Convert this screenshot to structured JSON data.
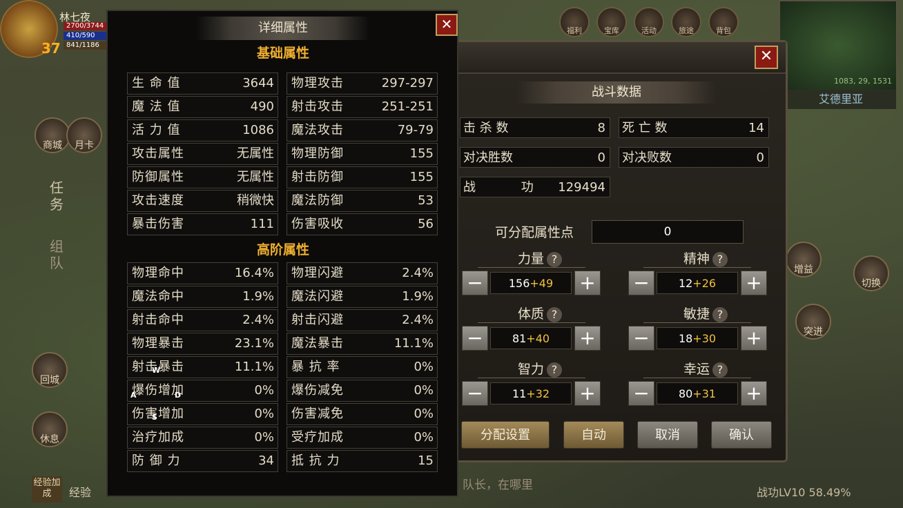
{
  "hud": {
    "name": "林七夜",
    "level": "37",
    "hp": "2700/3744",
    "mp": "410/590",
    "sp": "841/1186"
  },
  "top_icons": [
    "福利",
    "宝库",
    "活动",
    "旅途",
    "背包"
  ],
  "minimap": {
    "coord": "1083, 29, 1531"
  },
  "region_name": "艾德里亚",
  "left_hud": [
    "商城",
    "月卡",
    "回城",
    "休息"
  ],
  "left_tabs": [
    "任务",
    "组队"
  ],
  "right_hud": [
    "增益",
    "突进",
    "切换"
  ],
  "detail_panel": {
    "title": "详细属性",
    "close": "✕",
    "basic_title": "基础属性",
    "advanced_title": "高阶属性",
    "basic_left": [
      {
        "label": "生 命 值",
        "value": "3644"
      },
      {
        "label": "魔 法 值",
        "value": "490"
      },
      {
        "label": "活 力 值",
        "value": "1086"
      },
      {
        "label": "攻击属性",
        "value": "无属性"
      },
      {
        "label": "防御属性",
        "value": "无属性"
      },
      {
        "label": "攻击速度",
        "value": "稍微快"
      },
      {
        "label": "暴击伤害",
        "value": "111"
      }
    ],
    "basic_right": [
      {
        "label": "物理攻击",
        "value": "297-297"
      },
      {
        "label": "射击攻击",
        "value": "251-251"
      },
      {
        "label": "魔法攻击",
        "value": "79-79"
      },
      {
        "label": "物理防御",
        "value": "155"
      },
      {
        "label": "射击防御",
        "value": "155"
      },
      {
        "label": "魔法防御",
        "value": "53"
      },
      {
        "label": "伤害吸收",
        "value": "56"
      }
    ],
    "adv_left": [
      {
        "label": "物理命中",
        "value": "16.4%"
      },
      {
        "label": "魔法命中",
        "value": "1.9%"
      },
      {
        "label": "射击命中",
        "value": "2.4%"
      },
      {
        "label": "物理暴击",
        "value": "23.1%"
      },
      {
        "label": "射击暴击",
        "value": "11.1%"
      },
      {
        "label": "爆伤增加",
        "value": "0%"
      },
      {
        "label": "伤害增加",
        "value": "0%"
      },
      {
        "label": "治疗加成",
        "value": "0%"
      },
      {
        "label": "防 御 力",
        "value": "34"
      }
    ],
    "adv_right": [
      {
        "label": "物理闪避",
        "value": "2.4%"
      },
      {
        "label": "魔法闪避",
        "value": "1.9%"
      },
      {
        "label": "射击闪避",
        "value": "2.4%"
      },
      {
        "label": "魔法暴击",
        "value": "11.1%"
      },
      {
        "label": "暴 抗 率",
        "value": "0%"
      },
      {
        "label": "爆伤减免",
        "value": "0%"
      },
      {
        "label": "伤害减免",
        "value": "0%"
      },
      {
        "label": "受疗加成",
        "value": "0%"
      },
      {
        "label": "抵 抗 力",
        "value": "15"
      }
    ]
  },
  "keys": {
    "w": "W",
    "a": "A",
    "s": "S",
    "d": "D"
  },
  "combat_panel": {
    "close": "✕",
    "title": "战斗数据",
    "kills_label": "击 杀 数",
    "kills": "8",
    "deaths_label": "死 亡 数",
    "deaths": "14",
    "duel_win_label": "对决胜数",
    "duel_win": "0",
    "duel_lose_label": "对决败数",
    "duel_lose": "0",
    "merit_label": "战 功",
    "merit": "129494",
    "alloc_label": "可分配属性点",
    "alloc_value": "0",
    "attrs": [
      {
        "name": "力量",
        "base": "156",
        "bonus": "+49"
      },
      {
        "name": "精神",
        "base": "12",
        "bonus": "+26"
      },
      {
        "name": "体质",
        "base": "81",
        "bonus": "+40"
      },
      {
        "name": "敏捷",
        "base": "18",
        "bonus": "+30"
      },
      {
        "name": "智力",
        "base": "11",
        "bonus": "+32"
      },
      {
        "name": "幸运",
        "base": "80",
        "bonus": "+31"
      }
    ],
    "qmark": "?",
    "minus": "−",
    "plus": "+",
    "btn_config": "分配设置",
    "btn_auto": "自动",
    "btn_cancel": "取消",
    "btn_confirm": "确认"
  },
  "chat": "队长，在哪里",
  "exp_label": "经验加成",
  "exp_text": "经验",
  "bottom_right": "战功LV10 58.49%"
}
